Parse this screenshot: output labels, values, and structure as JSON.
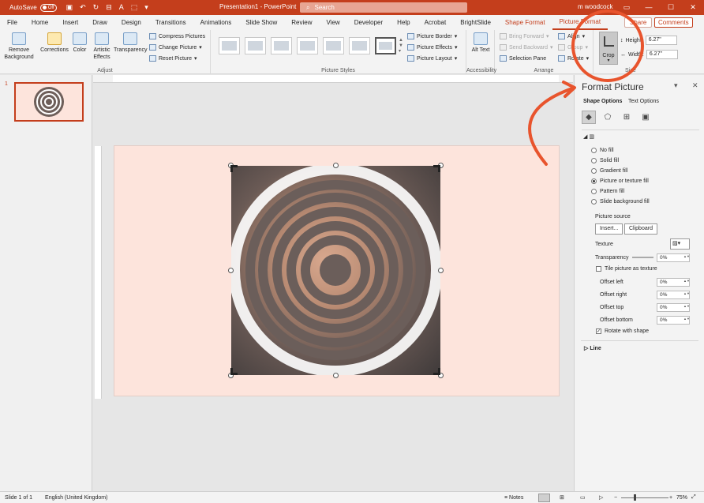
{
  "titlebar": {
    "autosave": "AutoSave",
    "autosave_state": "Off",
    "title": "Presentation1 - PowerPoint",
    "search": "Search",
    "user": "m woodcock"
  },
  "tabs": [
    {
      "label": "File"
    },
    {
      "label": "Home"
    },
    {
      "label": "Insert"
    },
    {
      "label": "Draw"
    },
    {
      "label": "Design"
    },
    {
      "label": "Transitions"
    },
    {
      "label": "Animations"
    },
    {
      "label": "Slide Show"
    },
    {
      "label": "Review"
    },
    {
      "label": "View"
    },
    {
      "label": "Developer"
    },
    {
      "label": "Help"
    },
    {
      "label": "Acrobat"
    },
    {
      "label": "BrightSlide"
    },
    {
      "label": "Shape Format"
    },
    {
      "label": "Picture Format"
    }
  ],
  "share": "Share",
  "comments": "Comments",
  "ribbon": {
    "remove_bg": "Remove Background",
    "corrections": "Corrections",
    "color": "Color",
    "artistic": "Artistic Effects",
    "transparency": "Transparency",
    "compress": "Compress Pictures",
    "change": "Change Picture",
    "reset": "Reset Picture",
    "adjust": "Adjust",
    "styles_label": "Picture Styles",
    "border": "Picture Border",
    "effects": "Picture Effects",
    "layout": "Picture Layout",
    "alt_text": "Alt Text",
    "accessibility": "Accessibility",
    "bring_forward": "Bring Forward",
    "send_backward": "Send Backward",
    "selection_pane": "Selection Pane",
    "align": "Align",
    "group": "Group",
    "rotate": "Rotate",
    "arrange": "Arrange",
    "crop": "Crop",
    "height_label": "Height:",
    "height": "6.27\"",
    "width_label": "Width:",
    "width": "6.27\"",
    "size": "Size"
  },
  "slide_number": "1",
  "pane": {
    "title": "Format Picture",
    "tab_shape": "Shape Options",
    "tab_text": "Text Options",
    "fill_options": [
      {
        "label": "No fill",
        "on": false
      },
      {
        "label": "Solid fill",
        "on": false
      },
      {
        "label": "Gradient fill",
        "on": false
      },
      {
        "label": "Picture or texture fill",
        "on": true
      },
      {
        "label": "Pattern fill",
        "on": false
      },
      {
        "label": "Slide background fill",
        "on": false
      }
    ],
    "picture_source": "Picture source",
    "insert": "Insert...",
    "clipboard": "Clipboard",
    "texture": "Texture",
    "transparency": "Transparency",
    "transparency_val": "0%",
    "tile": "Tile picture as texture",
    "offsets": [
      {
        "label": "Offset left",
        "val": "0%"
      },
      {
        "label": "Offset right",
        "val": "0%"
      },
      {
        "label": "Offset top",
        "val": "0%"
      },
      {
        "label": "Offset bottom",
        "val": "0%"
      }
    ],
    "rotate": "Rotate with shape",
    "line": "Line"
  },
  "status": {
    "slide": "Slide 1 of 1",
    "language": "English (United Kingdom)",
    "notes": "Notes",
    "zoom": "75%"
  },
  "annotation": {
    "color": "#e8542d"
  }
}
